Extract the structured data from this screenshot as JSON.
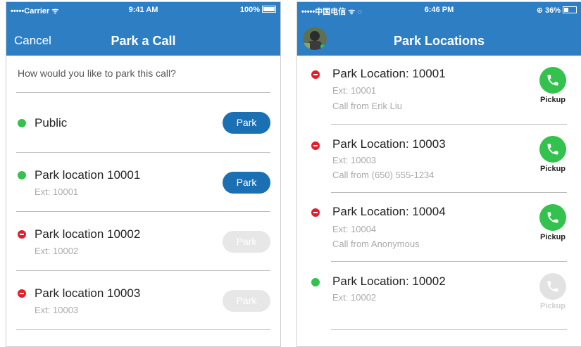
{
  "left_screen": {
    "status": {
      "carrier": "•••••Carrier ᯤ",
      "time": "9:41 AM",
      "battery": "100%"
    },
    "nav": {
      "cancel": "Cancel",
      "title": "Park a Call"
    },
    "prompt": "How would you like to park this call?",
    "options": [
      {
        "status": "available",
        "title": "Public",
        "ext": "",
        "button": "Park",
        "enabled": true
      },
      {
        "status": "available",
        "title": "Park location 10001",
        "ext": "Ext: 10001",
        "button": "Park",
        "enabled": true
      },
      {
        "status": "busy",
        "title": "Park location 10002",
        "ext": "Ext: 10002",
        "button": "Park",
        "enabled": false
      },
      {
        "status": "busy",
        "title": "Park location 10003",
        "ext": "Ext: 10003",
        "button": "Park",
        "enabled": false
      }
    ]
  },
  "right_screen": {
    "status": {
      "carrier": "•••••中国电信 ᯤ ◌",
      "time": "6:46 PM",
      "battery": "⊕ 36%"
    },
    "nav": {
      "title": "Park Locations"
    },
    "locations": [
      {
        "status": "busy",
        "title": "Park Location: 10001",
        "ext": "Ext: 10001",
        "caller": "Call from Erik Liu",
        "action": "Pickup",
        "enabled": true
      },
      {
        "status": "busy",
        "title": "Park Location: 10003",
        "ext": "Ext: 10003",
        "caller": "Call from (650) 555-1234",
        "action": "Pickup",
        "enabled": true
      },
      {
        "status": "busy",
        "title": "Park Location: 10004",
        "ext": "Ext: 10004",
        "caller": "Call from Anonymous",
        "action": "Pickup",
        "enabled": true
      },
      {
        "status": "available",
        "title": "Park Location: 10002",
        "ext": "Ext: 10002",
        "caller": "",
        "action": "Pickup",
        "enabled": false
      }
    ]
  },
  "colors": {
    "nav_blue": "#2e7ec4",
    "button_blue": "#1b6fb3",
    "available_green": "#33c24d",
    "busy_red": "#e31e2a",
    "disabled_gray": "#e7e7e7"
  },
  "icons": {
    "avatar": "user-avatar-photo",
    "pickup": "phone-handset-icon",
    "available": "green-dot-icon",
    "busy": "red-minus-icon"
  }
}
